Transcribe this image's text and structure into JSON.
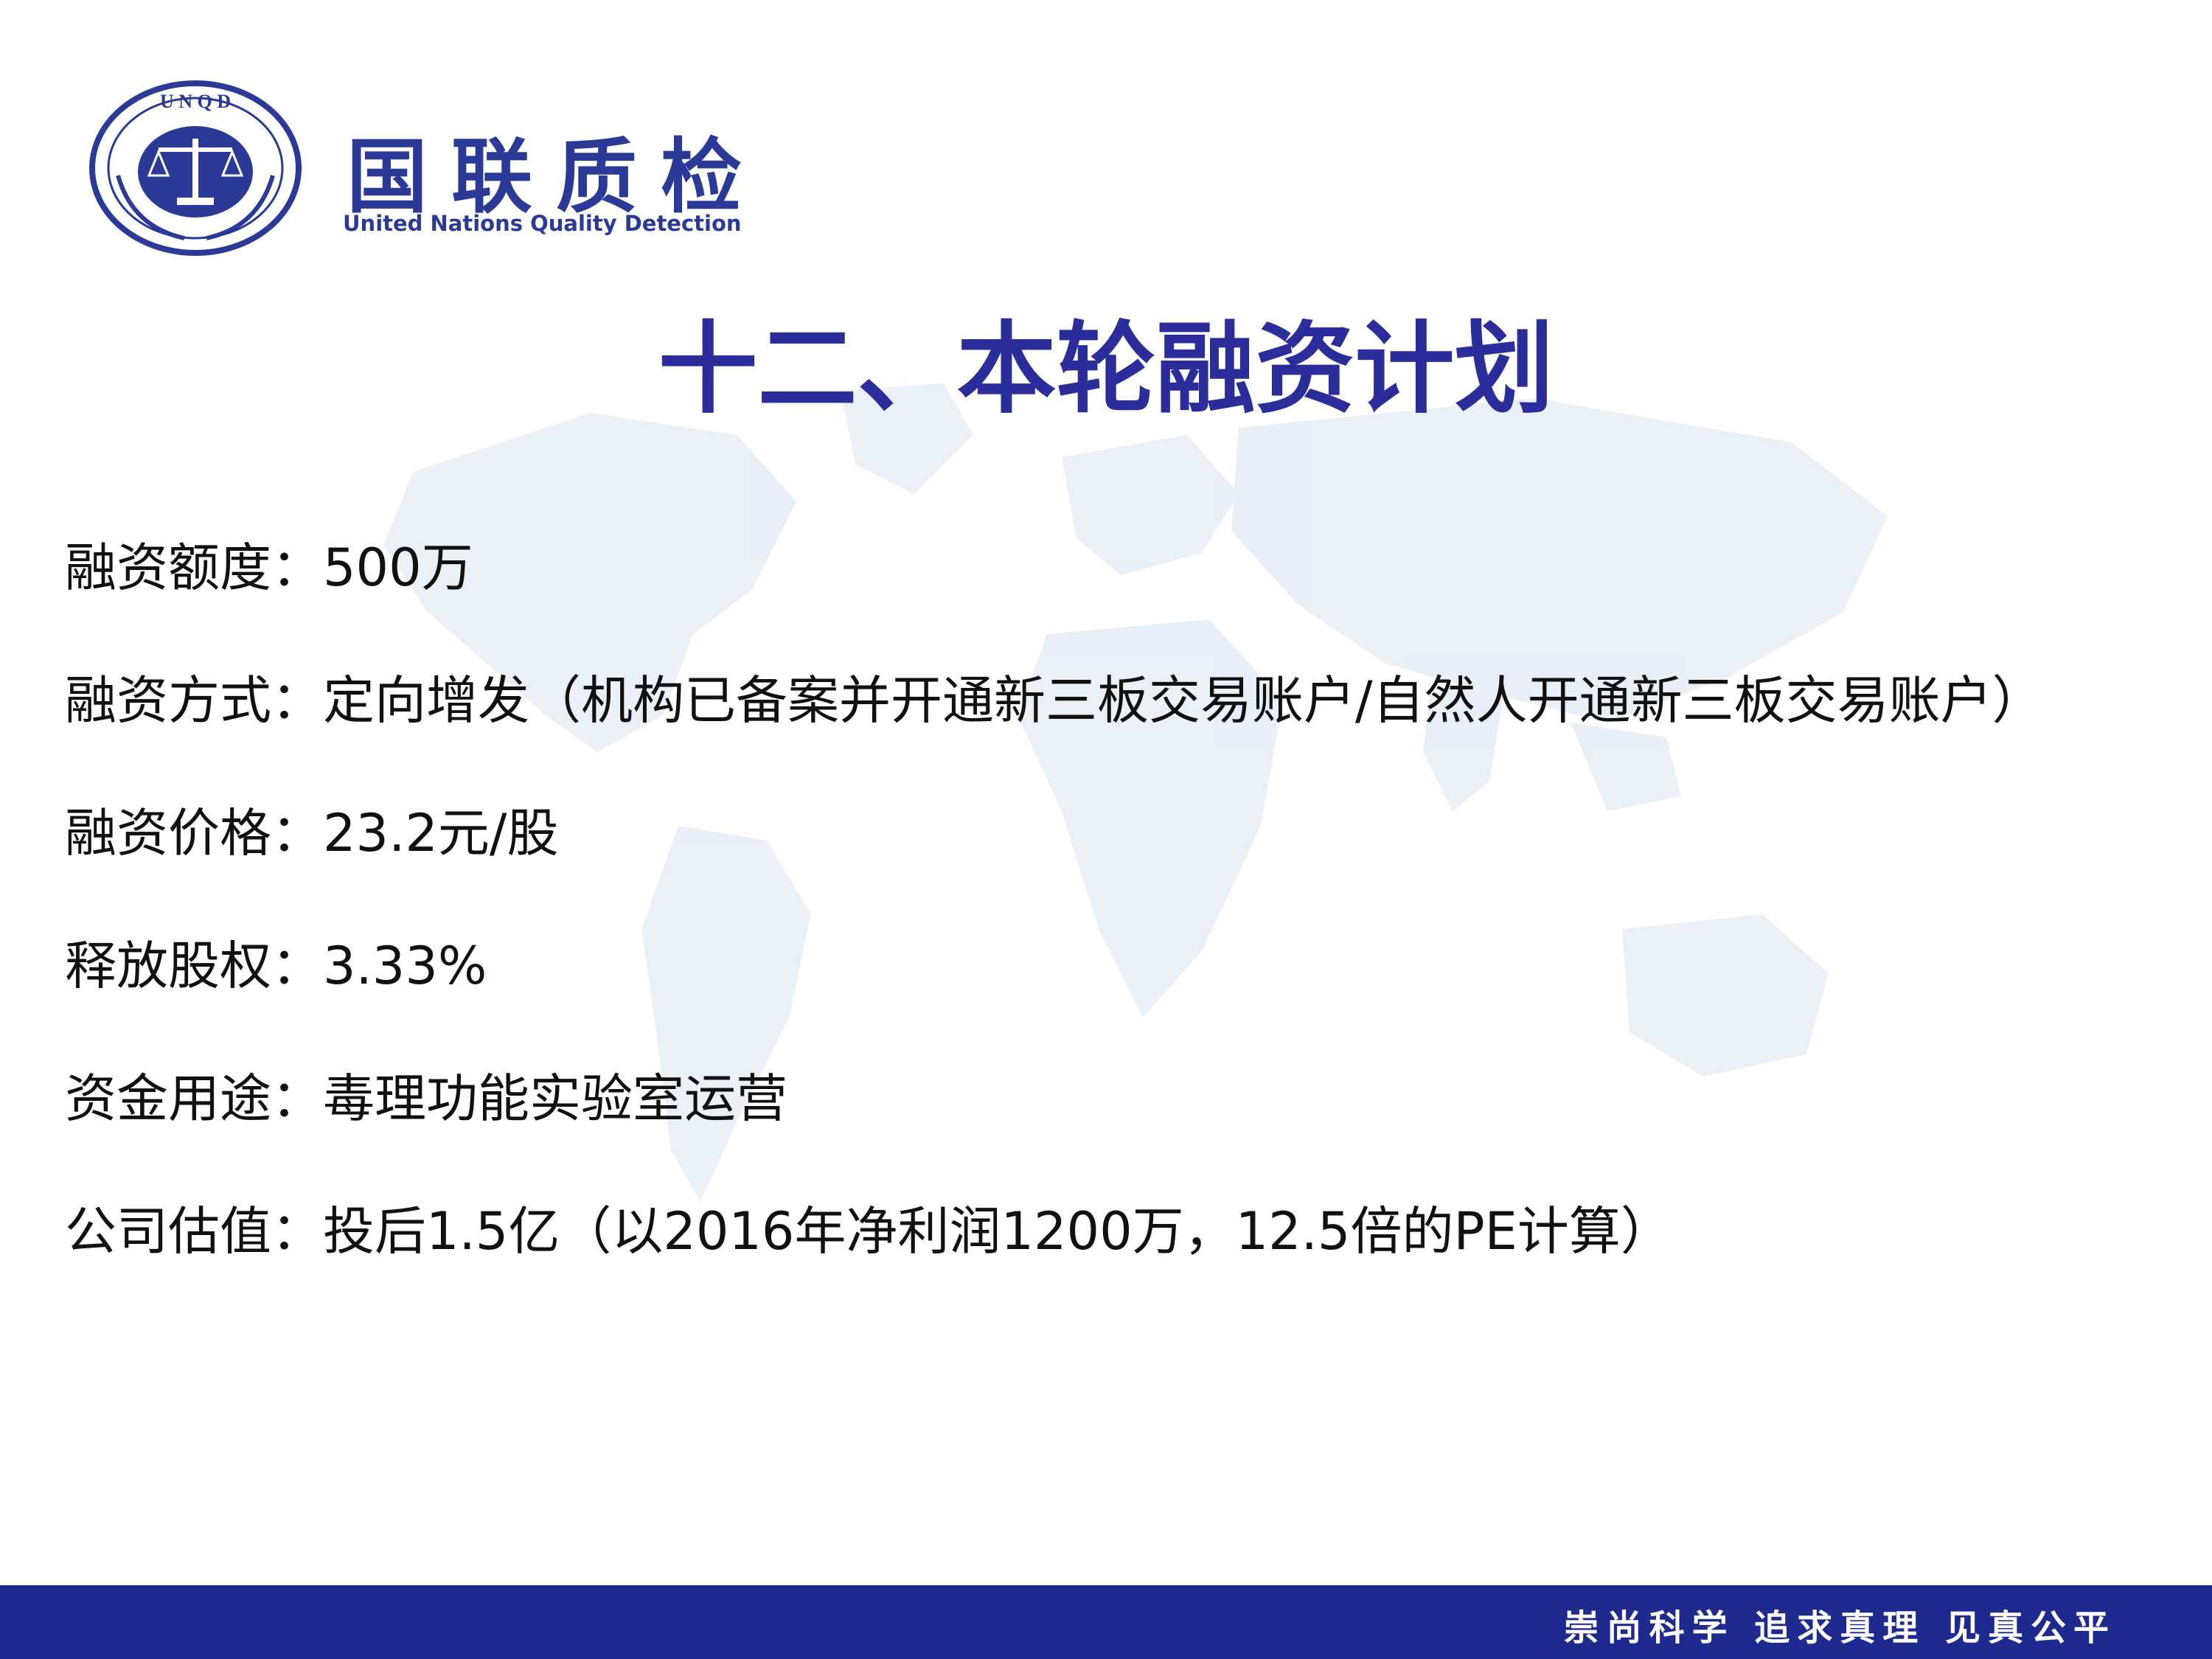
{
  "brand": {
    "name_cn": "国联质检",
    "name_en": "United Nations Quality Detection",
    "seal_letters": "UNQD",
    "color": "#2a3a96"
  },
  "title": "十二、本轮融资计划",
  "items": [
    {
      "label": "融资额度",
      "sep": "：",
      "value": "500万"
    },
    {
      "label": "融资方式",
      "sep": "：",
      "value": "定向增发（机构已备案并开通新三板交易账户/自然人开通新三板交易账户）"
    },
    {
      "label": "融资价格",
      "sep": "：",
      "value": "23.2元/股"
    },
    {
      "label": "释放股权",
      "sep": "：",
      "value": "3.33%"
    },
    {
      "label": "资金用途",
      "sep": "：",
      "value": "毒理功能实验室运营"
    },
    {
      "label": "公司估值",
      "sep": "：",
      "value": "投后1.5亿（以2016年净利润1200万，12.5倍的PE计算）"
    }
  ],
  "footer": {
    "slogan": "崇尚科学 追求真理 见真公平",
    "bar_color": "#1f2a8f"
  }
}
